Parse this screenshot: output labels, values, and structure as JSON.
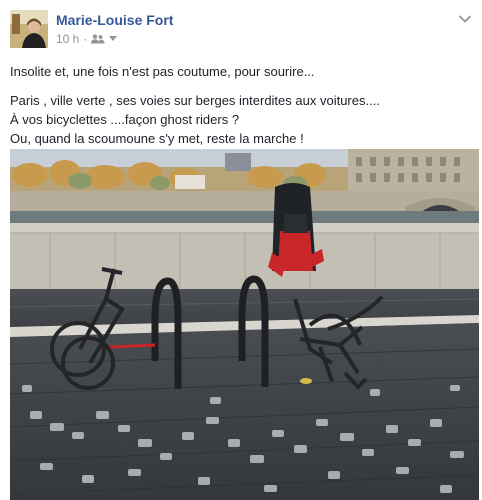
{
  "post": {
    "author": "Marie-Louise Fort",
    "timestamp": "10 h",
    "separator": "·",
    "audience_icon": "friends-icon",
    "menu_icon": "chevron-down-icon",
    "text_lines": [
      "Insolite et, une fois n'est pas coutume, pour sourire...",
      "Paris , ville verte , ses voies sur berges interdites aux voitures....",
      "À vos bicyclettes ....façon ghost riders ?",
      "Ou, quand la scoumoune s'y met, reste la marche !"
    ]
  },
  "photo": {
    "subject": "bicycle-rack-photo",
    "colors": {
      "sky": "#cfd6dc",
      "wall": "#c7c2b7",
      "pavement": "#3f4246",
      "seat_red": "#c9262a"
    }
  }
}
